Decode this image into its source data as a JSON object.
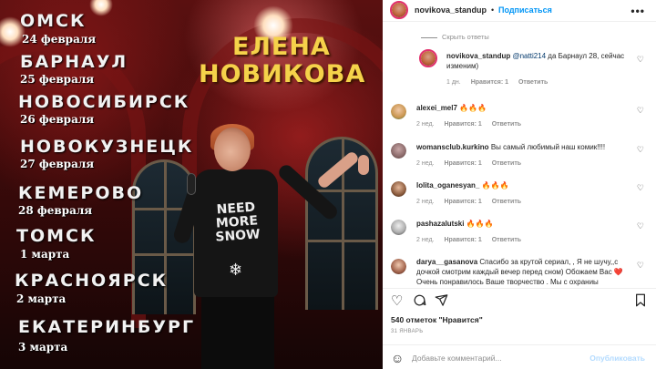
{
  "poster": {
    "artist_line1": "ЕЛЕНА",
    "artist_line2": "НОВИКОВА",
    "shirt_text": "NEED MORE SNOW",
    "tour": [
      {
        "city": "ОМСК",
        "date": "24 февраля"
      },
      {
        "city": "БАРНАУЛ",
        "date": "25 февраля"
      },
      {
        "city": "НОВОСИБИРСК",
        "date": "26 февраля"
      },
      {
        "city": "НОВОКУЗНЕЦК",
        "date": "27 февраля"
      },
      {
        "city": "КЕМЕРОВО",
        "date": "28 февраля"
      },
      {
        "city": "ТОМСК",
        "date": "1 марта"
      },
      {
        "city": "КРАСНОЯРСК",
        "date": "2 марта"
      },
      {
        "city": "ЕКАТЕРИНБУРГ",
        "date": "3 марта"
      }
    ]
  },
  "header": {
    "username": "novikova_standup",
    "separator": "•",
    "follow_label": "Подписаться",
    "more_icon": "more-dots-icon"
  },
  "thread": {
    "hide_replies_label": "Скрыть ответы",
    "reply": {
      "username": "novikova_standup",
      "mention": "@natti214",
      "text": " да Барнаул 28, сейчас изменим)",
      "time": "1 дн.",
      "likes": "Нравится: 1",
      "reply_label": "Ответить"
    }
  },
  "comments": [
    {
      "username": "alexei_mel7",
      "text": "🔥🔥🔥",
      "time": "2 нед.",
      "likes": "Нравится: 1",
      "reply_label": "Ответить"
    },
    {
      "username": "womansclub.kurkino",
      "text": "Вы самый любимый наш комик!!!!",
      "time": "2 нед.",
      "likes": "Нравится: 1",
      "reply_label": "Ответить"
    },
    {
      "username": "lolita_oganesyan_",
      "text": "🔥🔥🔥",
      "time": "2 нед.",
      "likes": "Нравится: 1",
      "reply_label": "Ответить"
    },
    {
      "username": "pashazalutski",
      "text": "🔥🔥🔥",
      "time": "2 нед.",
      "likes": "Нравится: 1",
      "reply_label": "Ответить"
    },
    {
      "username": "darya__gasanova",
      "text": "Спасибо за крутой сериал, , Я не шучу,,с дочкой смотрим каждый вечер перед сном) Обожаем Вас ❤️ Очень понравилось Ваше творчество . Мы с охраниы",
      "time": "",
      "likes": "",
      "reply_label": ""
    }
  ],
  "post": {
    "likes": "540 отметок \"Нравится\"",
    "date": "31 ЯНВАРЬ"
  },
  "composer": {
    "placeholder": "Добавьте комментарий...",
    "publish_label": "Опубликовать"
  },
  "colors": {
    "accent": "#0095f6",
    "poster_city": "#f2f2f2",
    "poster_artist": "#f5d24a",
    "fire": "#e8671b"
  }
}
